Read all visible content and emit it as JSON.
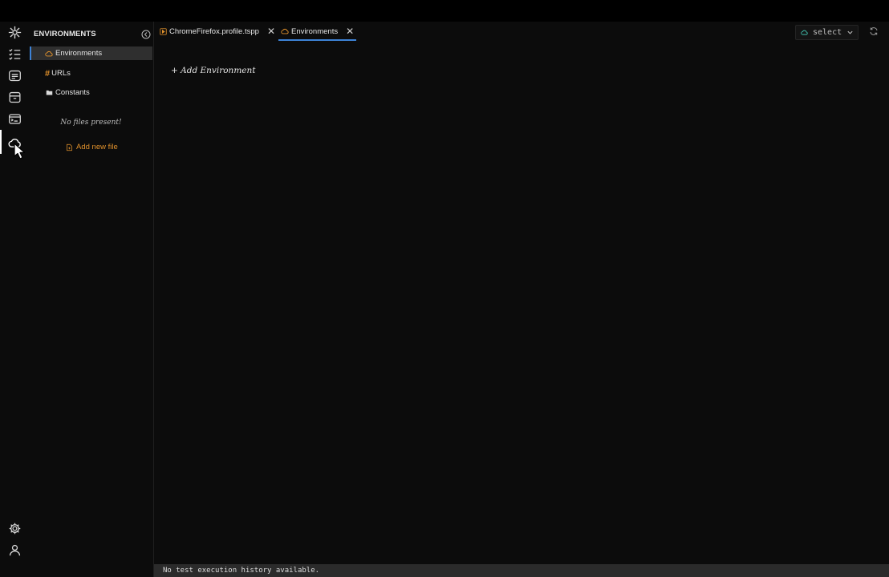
{
  "activity_bar": {
    "items": [
      {
        "icon": "logo-icon"
      },
      {
        "icon": "checklist-icon"
      },
      {
        "icon": "document-list-icon"
      },
      {
        "icon": "archive-icon"
      },
      {
        "icon": "terminal-card-icon"
      },
      {
        "icon": "cloud-icon",
        "active": true
      }
    ],
    "bottom": [
      {
        "icon": "gear-icon"
      },
      {
        "icon": "user-icon"
      }
    ]
  },
  "explorer": {
    "title": "ENVIRONMENTS",
    "items": [
      {
        "label": "Environments",
        "icon": "cloud-icon",
        "selected": true
      },
      {
        "label": "URLs",
        "icon": "hash-icon"
      },
      {
        "label": "Constants",
        "icon": "folder-icon"
      }
    ],
    "empty_message": "No files present!",
    "add_file_label": "Add new file"
  },
  "tabs": [
    {
      "label": "ChromeFirefox.profile.tspp",
      "icon": "play-file-icon",
      "active": false
    },
    {
      "label": "Environments",
      "icon": "cloud-icon",
      "active": true
    }
  ],
  "environment_select": {
    "value": "select"
  },
  "main": {
    "add_environment_label": "+ Add Environment"
  },
  "status_bar": {
    "message": "No test execution history available."
  },
  "colors": {
    "accent": "#3d82d6",
    "orange": "#e0912c",
    "teal": "#3fb8a6"
  }
}
